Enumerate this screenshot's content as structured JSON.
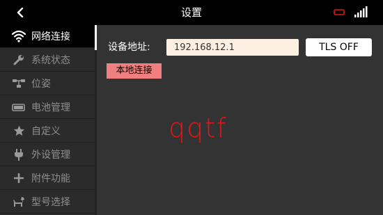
{
  "topbar": {
    "title": "设置",
    "back_icon": "chevron-left-icon",
    "battery_icon": "battery-icon",
    "signal_icon": "signal-bars-icon",
    "battery_color": "#e01818"
  },
  "sidebar": {
    "items": [
      {
        "label": "网络连接",
        "icon": "wifi-icon",
        "active": true
      },
      {
        "label": "系统状态",
        "icon": "wrench-icon",
        "active": false
      },
      {
        "label": "位姿",
        "icon": "hierarchy-icon",
        "active": false
      },
      {
        "label": "电池管理",
        "icon": "battery-bar-icon",
        "active": false
      },
      {
        "label": "自定义",
        "icon": "star-icon",
        "active": false
      },
      {
        "label": "外设管理",
        "icon": "plug-icon",
        "active": false
      },
      {
        "label": "附件功能",
        "icon": "plus-icon",
        "active": false
      },
      {
        "label": "型号选择",
        "icon": "dog-icon",
        "active": false
      }
    ]
  },
  "network": {
    "address_label": "设备地址:",
    "address_value": "192.168.12.1",
    "tls_button": "TLS OFF",
    "local_button": "本地连接"
  },
  "watermark": "qqtf",
  "colors": {
    "accent_local": "#f08080",
    "input_bg": "#fdf0e2",
    "watermark": "#e01818"
  }
}
